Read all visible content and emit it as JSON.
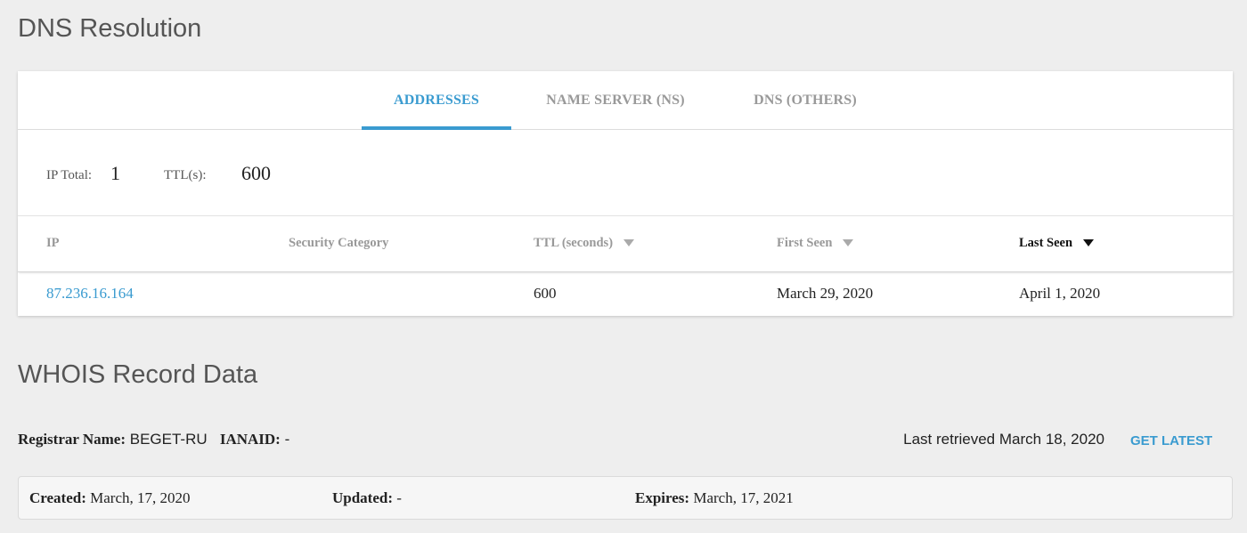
{
  "dns": {
    "title": "DNS Resolution",
    "tabs": [
      {
        "label": "ADDRESSES",
        "active": true
      },
      {
        "label": "NAME SERVER (NS)",
        "active": false
      },
      {
        "label": "DNS (OTHERS)",
        "active": false
      }
    ],
    "summary": {
      "ip_total_label": "IP Total:",
      "ip_total_value": "1",
      "ttl_label": "TTL(s):",
      "ttl_value": "600"
    },
    "table": {
      "columns": [
        "IP",
        "Security Category",
        "TTL (seconds)",
        "First Seen",
        "Last Seen"
      ],
      "rows": [
        {
          "ip": "87.236.16.164",
          "security_category": "",
          "ttl": "600",
          "first_seen": "March 29, 2020",
          "last_seen": "April 1, 2020"
        }
      ]
    }
  },
  "whois": {
    "title": "WHOIS Record Data",
    "registrar_label": "Registrar Name:",
    "registrar_value": "BEGET-RU",
    "ianaid_label": "IANAID:",
    "ianaid_value": "-",
    "last_retrieved": "Last retrieved March 18, 2020",
    "get_latest_label": "GET LATEST",
    "created_label": "Created:",
    "created_value": "March, 17, 2020",
    "updated_label": "Updated:",
    "updated_value": "-",
    "expires_label": "Expires:",
    "expires_value": "March, 17, 2021"
  },
  "colors": {
    "accent": "#3a9bd0",
    "background": "#eeeeee",
    "card": "#ffffff"
  }
}
